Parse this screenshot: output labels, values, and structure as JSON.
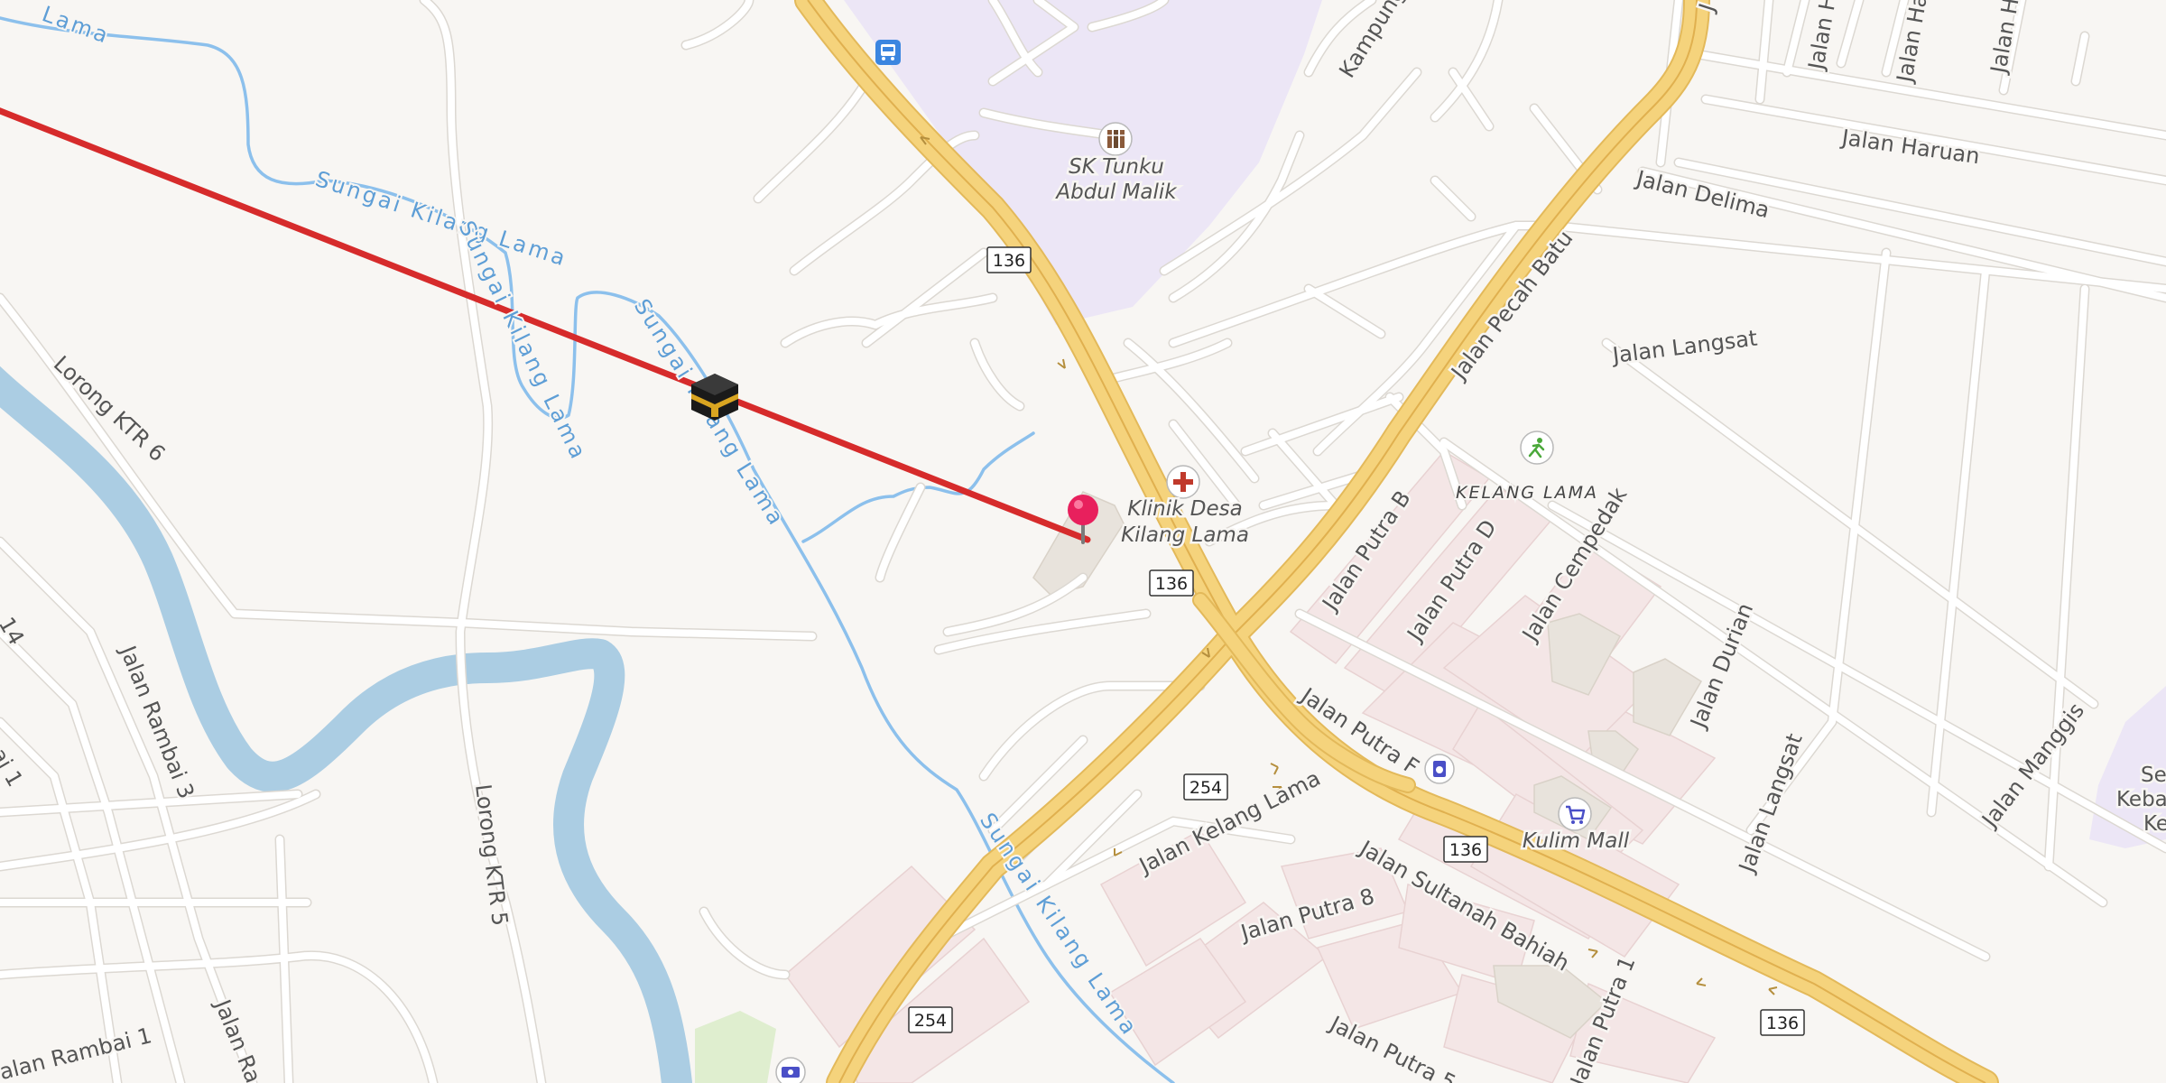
{
  "map": {
    "roads": {
      "jalan_putra_b": "Jalan Putra B",
      "jalan_putra_d": "Jalan Putra D",
      "jalan_putra_f": "Jalan Putra F",
      "jalan_putra_8": "Jalan Putra 8",
      "jalan_putra_1": "Jalan Putra 1",
      "jalan_putra_partial": "Jalan Putra 5",
      "jalan_pecah_batu": "Jalan Pecah Batu",
      "jalan_delima": "Jalan Delima",
      "jalan_langsat_1": "Jalan Langsat",
      "jalan_langsat_2": "Jalan Langsat",
      "jalan_cempedak": "Jalan Cempedak",
      "jalan_durian": "Jalan Durian",
      "jalan_manggis": "Jalan Manggis",
      "jalan_haruan": "Jalan Haruan",
      "jalan_kelang_lama": "Jalan Kelang Lama",
      "jalan_sultanah_bahiah": "Jalan Sultanah Bahiah",
      "lorong_ktr_6": "Lorong KTR 6",
      "lorong_ktr_5": "Lorong KTR 5",
      "jalan_rambai_3": "Jalan Rambai 3",
      "jalan_rambai_1": "Jalan Rambai 1",
      "jalan_rambai_1b": "Rambai 1",
      "jalan_ra": "Jalan Ra",
      "kampung": "Kampung",
      "jalan_h1": "Jalan H",
      "jalan_h2": "Jalan Har",
      "jalan_h3": "Jalan H",
      "jalan_j": "J",
      "edge_14": "14"
    },
    "water": {
      "stream_1": "Sungai Kilang Lama",
      "stream_2": "Sungai Kilang Lama",
      "stream_3": "Sungai Kilang Lama",
      "stream_4": "Sungai Kilang Lama",
      "stream_top": "Lama"
    },
    "shields": {
      "s136a": "136",
      "s136b": "136",
      "s136c": "136",
      "s136d": "136",
      "s254a": "254",
      "s254b": "254"
    },
    "pois": {
      "school_line1": "SK Tunku",
      "school_line2": "Abdul Malik",
      "clinic_line1": "Klinik Desa",
      "clinic_line2": "Kilang Lama",
      "mall": "Kulim Mall",
      "area": "KELANG LAMA",
      "se_line1": "Se",
      "se_line2": "Kebar",
      "se_line3": "Ke"
    },
    "icons": {
      "bus": "bus-stop-icon",
      "school": "school-icon",
      "clinic": "medical-cross-icon",
      "sports": "sports-icon",
      "mall": "shopping-cart-icon",
      "atm": "atm-icon",
      "money": "money-icon",
      "kaaba": "kaaba-icon",
      "pin": "location-pin-icon"
    },
    "colors": {
      "background": "#f8f6f3",
      "major_road": "#f5d37c",
      "water": "#abcde3",
      "stream": "#8cc0ec",
      "school_area": "#ece6f6",
      "commercial": "#f4e6e6",
      "qibla_line": "#d62b2b",
      "pin": "#e8205d"
    }
  }
}
